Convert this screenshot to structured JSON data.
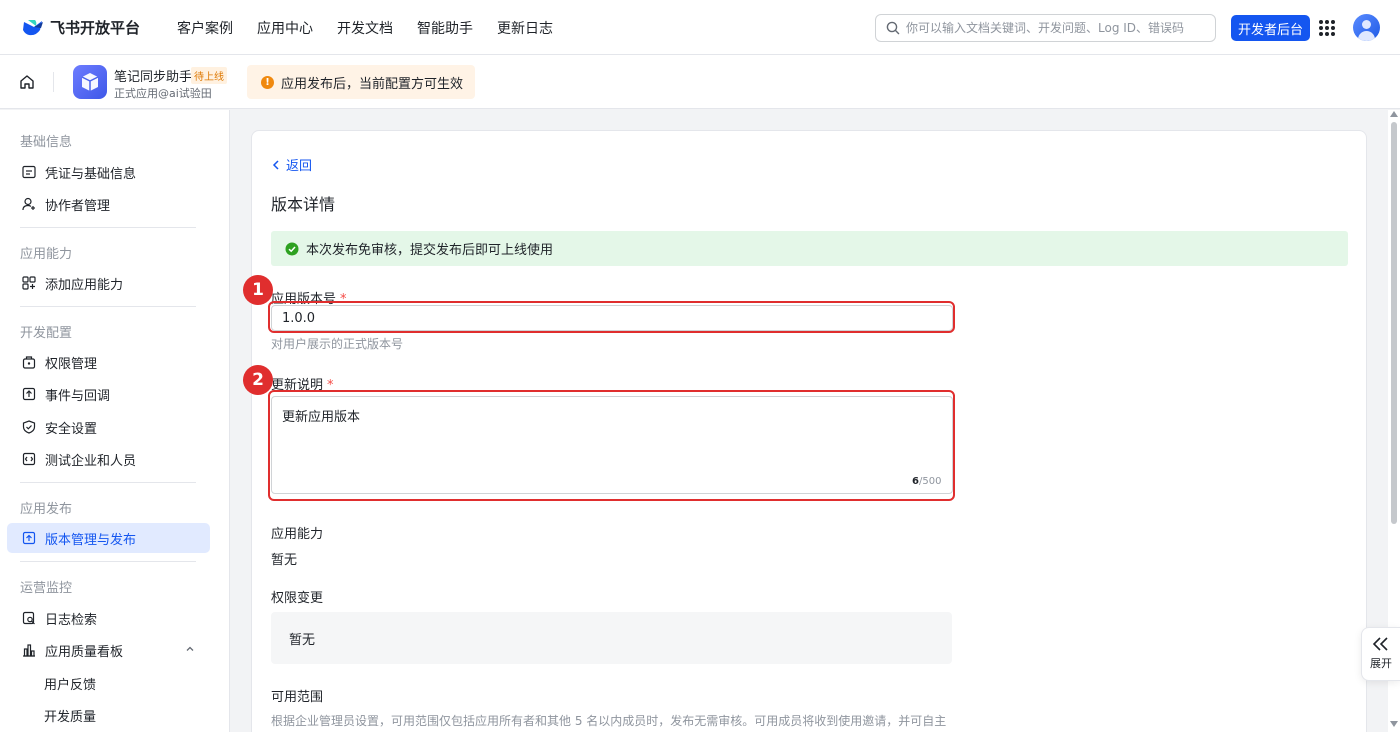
{
  "brand": {
    "name": "飞书开放平台"
  },
  "nav": {
    "links": [
      "客户案例",
      "应用中心",
      "开发文档",
      "智能助手",
      "更新日志"
    ],
    "search_placeholder": "你可以输入文档关键词、开发问题、Log ID、错误码",
    "dev_console": "开发者后台"
  },
  "app": {
    "name": "笔记同步助手",
    "badge": "待上线",
    "subtitle": "正式应用@ai试验田",
    "notice": "应用发布后，当前配置方可生效"
  },
  "sidebar": {
    "sections": [
      {
        "title": "基础信息",
        "items": [
          {
            "label": "凭证与基础信息",
            "icon": "credential-icon"
          },
          {
            "label": "协作者管理",
            "icon": "collaborator-icon"
          }
        ]
      },
      {
        "title": "应用能力",
        "items": [
          {
            "label": "添加应用能力",
            "icon": "add-capability-icon"
          }
        ]
      },
      {
        "title": "开发配置",
        "items": [
          {
            "label": "权限管理",
            "icon": "permission-icon"
          },
          {
            "label": "事件与回调",
            "icon": "event-icon"
          },
          {
            "label": "安全设置",
            "icon": "shield-icon"
          },
          {
            "label": "测试企业和人员",
            "icon": "test-icon"
          }
        ]
      },
      {
        "title": "应用发布",
        "items": [
          {
            "label": "版本管理与发布",
            "icon": "upload-icon",
            "active": true
          }
        ]
      },
      {
        "title": "运营监控",
        "items": [
          {
            "label": "日志检索",
            "icon": "log-search-icon"
          },
          {
            "label": "应用质量看板",
            "icon": "chart-icon",
            "expanded": true
          },
          {
            "label": "用户反馈"
          },
          {
            "label": "开发质量"
          }
        ]
      }
    ]
  },
  "main": {
    "back": "返回",
    "title": "版本详情",
    "success_msg": "本次发布免审核，提交发布后即可上线使用",
    "version": {
      "label": "应用版本号",
      "required_mark": "*",
      "value": "1.0.0",
      "hint": "对用户展示的正式版本号"
    },
    "notes": {
      "label": "更新说明",
      "required_mark": "*",
      "value": "更新应用版本",
      "count": "6",
      "max": "/500"
    },
    "capability": {
      "label": "应用能力",
      "value": "暂无"
    },
    "permission": {
      "label": "权限变更",
      "value": "暂无"
    },
    "range": {
      "label": "可用范围",
      "desc": "根据企业管理员设置，可用范围仅包括应用所有者和其他 5 名以内成员时，发布无需审核。可用成员将收到使用邀请，并可自主"
    }
  },
  "annotations": {
    "badge1": "1",
    "badge2": "2",
    "color": "#e02e2e"
  },
  "expand_panel": {
    "label": "展开"
  },
  "colors": {
    "accent": "#1456f0",
    "success_bg": "#e4f7e8",
    "notice_bg": "#fff3e6",
    "required": "#f54a45"
  }
}
